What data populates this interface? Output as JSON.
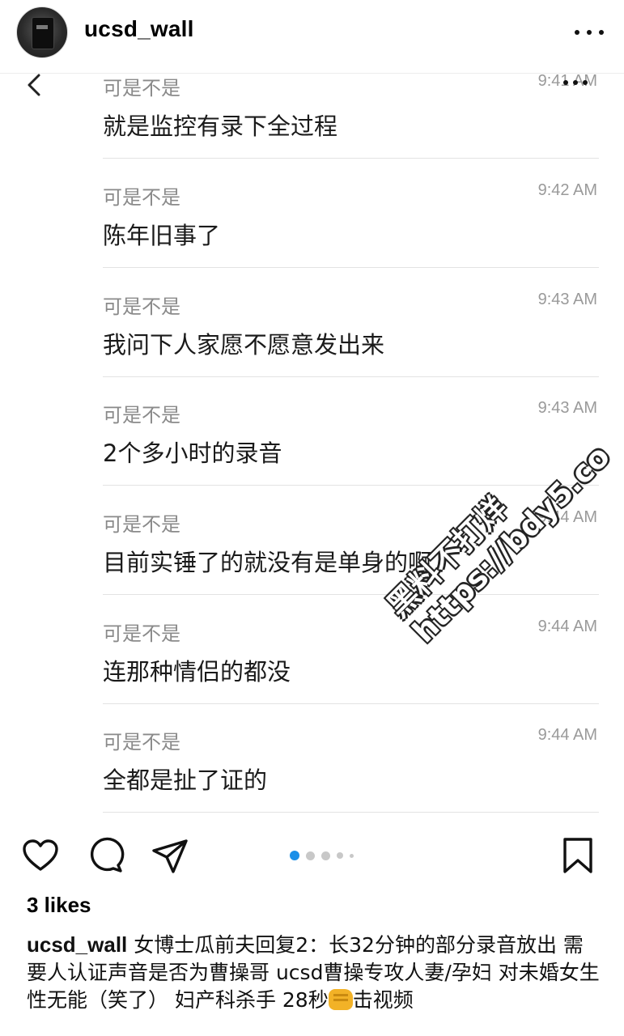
{
  "header": {
    "username": "ucsd_wall",
    "avatar_icon": "door-lock-avatar",
    "more_icon": "more-horizontal-icon"
  },
  "conversation": {
    "partial_top": {
      "sender": "可是不是",
      "time": "9:41 AM",
      "text": "就是监控有录下全过程"
    },
    "messages": [
      {
        "sender": "可是不是",
        "time": "9:42 AM",
        "text": "陈年旧事了"
      },
      {
        "sender": "可是不是",
        "time": "9:43 AM",
        "text": "我问下人家愿不愿意发出来"
      },
      {
        "sender": "可是不是",
        "time": "9:43 AM",
        "text": "2个多小时的录音"
      },
      {
        "sender": "可是不是",
        "time": "9:44 AM",
        "text": "目前实锤了的就没有是单身的啊"
      },
      {
        "sender": "可是不是",
        "time": "9:44 AM",
        "text": "连那种情侣的都没"
      },
      {
        "sender": "可是不是",
        "time": "9:44 AM",
        "text": "全都是扯了证的"
      }
    ]
  },
  "watermark": {
    "line1": "黑料不打烊",
    "line2": "https://bdy5.co"
  },
  "actions": {
    "like_icon": "heart-icon",
    "comment_icon": "comment-icon",
    "share_icon": "send-icon",
    "save_icon": "bookmark-icon",
    "active_dot_color": "#1a8fe8"
  },
  "post": {
    "likes": "3 likes",
    "caption_user": "ucsd_wall",
    "caption_text_1": " 女博士瓜前夫回复2：长32分钟的部分录音放出 需要人认证声音是否为曹操哥 ucsd曹操专攻人妻/孕妇 对未婚女生性无能（笑了） 妇产科杀手 28秒",
    "caption_emoji": "fist-emoji",
    "caption_text_2": "击视频"
  }
}
